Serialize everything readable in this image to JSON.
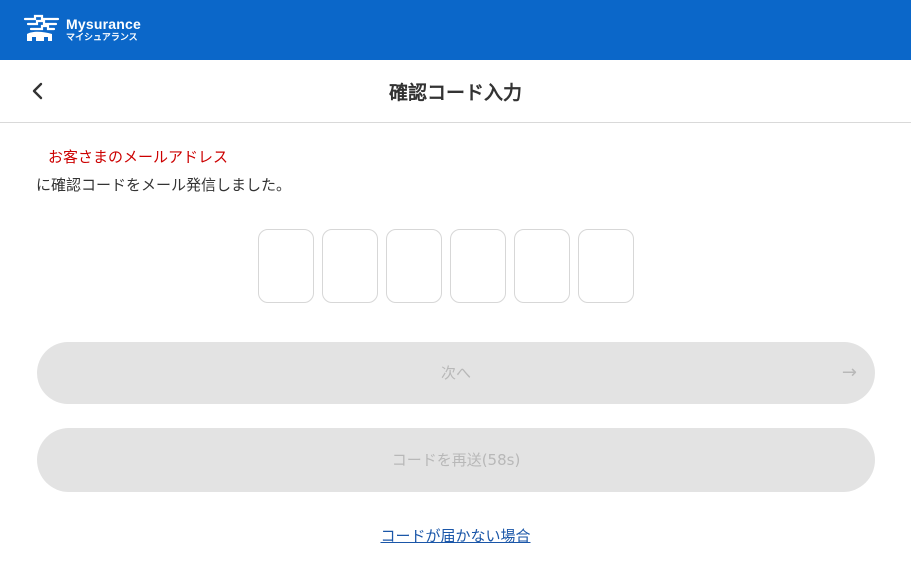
{
  "brand": {
    "name_en": "Mysurance",
    "name_ja": "マイシュアランス",
    "color": "#0b67c9"
  },
  "header": {
    "title": "確認コード入力",
    "back_icon": "chevron-left-icon"
  },
  "intro": {
    "email": "お客さまのメールアドレス",
    "message": "に確認コードをメール発信しました。"
  },
  "code_input": {
    "length": 6,
    "values": [
      "",
      "",
      "",
      "",
      "",
      ""
    ]
  },
  "buttons": {
    "next_label": "次へ",
    "next_icon": "arrow-right-icon",
    "resend_label": "コードを再送(58s)"
  },
  "help": {
    "link_label": "コードが届かない場合"
  }
}
